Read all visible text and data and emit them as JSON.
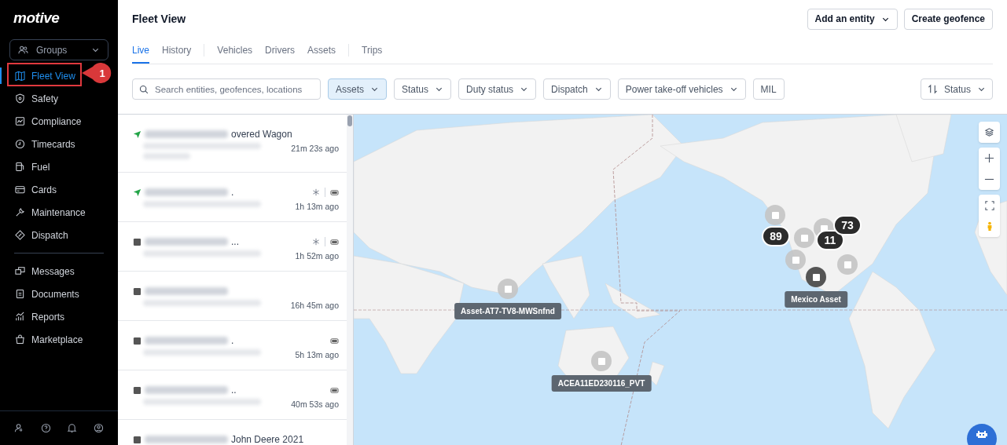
{
  "sidebar": {
    "logo": "motive",
    "groups_dropdown": {
      "label": "Groups"
    },
    "items": [
      {
        "label": "Fleet View",
        "selected": true
      },
      {
        "label": "Safety",
        "selected": false
      },
      {
        "label": "Compliance",
        "selected": false
      },
      {
        "label": "Timecards",
        "selected": false
      },
      {
        "label": "Fuel",
        "selected": false
      },
      {
        "label": "Cards",
        "selected": false
      },
      {
        "label": "Maintenance",
        "selected": false
      },
      {
        "label": "Dispatch",
        "selected": false
      },
      {
        "label": "Messages",
        "selected": false
      },
      {
        "label": "Documents",
        "selected": false
      },
      {
        "label": "Reports",
        "selected": false
      },
      {
        "label": "Marketplace",
        "selected": false
      }
    ],
    "callout": "1"
  },
  "header": {
    "title": "Fleet View",
    "buttons": [
      {
        "label": "Add an entity"
      },
      {
        "label": "Create geofence"
      }
    ]
  },
  "tabs": [
    {
      "label": "Live",
      "selected": true
    },
    {
      "label": "History",
      "selected": false
    },
    {
      "label": "Vehicles",
      "selected": false
    },
    {
      "label": "Drivers",
      "selected": false
    },
    {
      "label": "Assets",
      "selected": false
    },
    {
      "label": "Trips",
      "selected": false
    }
  ],
  "filters": {
    "search": {
      "placeholder": "Search entities, geofences, locations"
    },
    "chips": [
      {
        "label": "Assets",
        "selected": true
      },
      {
        "label": "Status",
        "selected": false
      },
      {
        "label": "Duty status",
        "selected": false
      },
      {
        "label": "Dispatch",
        "selected": false
      },
      {
        "label": "Power take-off vehicles",
        "selected": false
      },
      {
        "label": "MIL",
        "selected": false
      }
    ],
    "sort": {
      "label": "Status"
    }
  },
  "entity_list": [
    {
      "kind": "moving",
      "visible_name": "overed Wagon",
      "snowflake": false,
      "battery": false,
      "time": "21m 23s ago"
    },
    {
      "kind": "moving",
      "visible_name": ".",
      "snowflake": true,
      "battery": true,
      "time": "1h 13m ago"
    },
    {
      "kind": "stopped",
      "visible_name": "...",
      "snowflake": true,
      "battery": true,
      "time": "1h 52m ago"
    },
    {
      "kind": "stopped",
      "snowflake": false,
      "battery": false,
      "time": "16h 45m ago"
    },
    {
      "kind": "stopped",
      "visible_name": ".",
      "snowflake": false,
      "battery": true,
      "time": "5h 13m ago"
    },
    {
      "kind": "stopped",
      "visible_name": "..",
      "snowflake": false,
      "battery": true,
      "time": "40m 53s ago"
    },
    {
      "kind": "stopped",
      "visible_name": "John Deere 2021",
      "snowflake": false,
      "battery": false
    }
  ],
  "map": {
    "markers": [
      {
        "kind": "asset",
        "label": "Asset-AT7-TV8-MWSnfnd"
      },
      {
        "kind": "asset",
        "label": "ACEA11ED230116_PVT"
      },
      {
        "kind": "asset"
      },
      {
        "kind": "asset"
      },
      {
        "kind": "asset"
      },
      {
        "kind": "asset"
      },
      {
        "kind": "asset"
      },
      {
        "kind": "cluster",
        "count": "89"
      },
      {
        "kind": "cluster",
        "count": "11"
      },
      {
        "kind": "cluster",
        "count": "73"
      },
      {
        "kind": "asset_dark",
        "label": "Mexico Asset"
      }
    ]
  }
}
